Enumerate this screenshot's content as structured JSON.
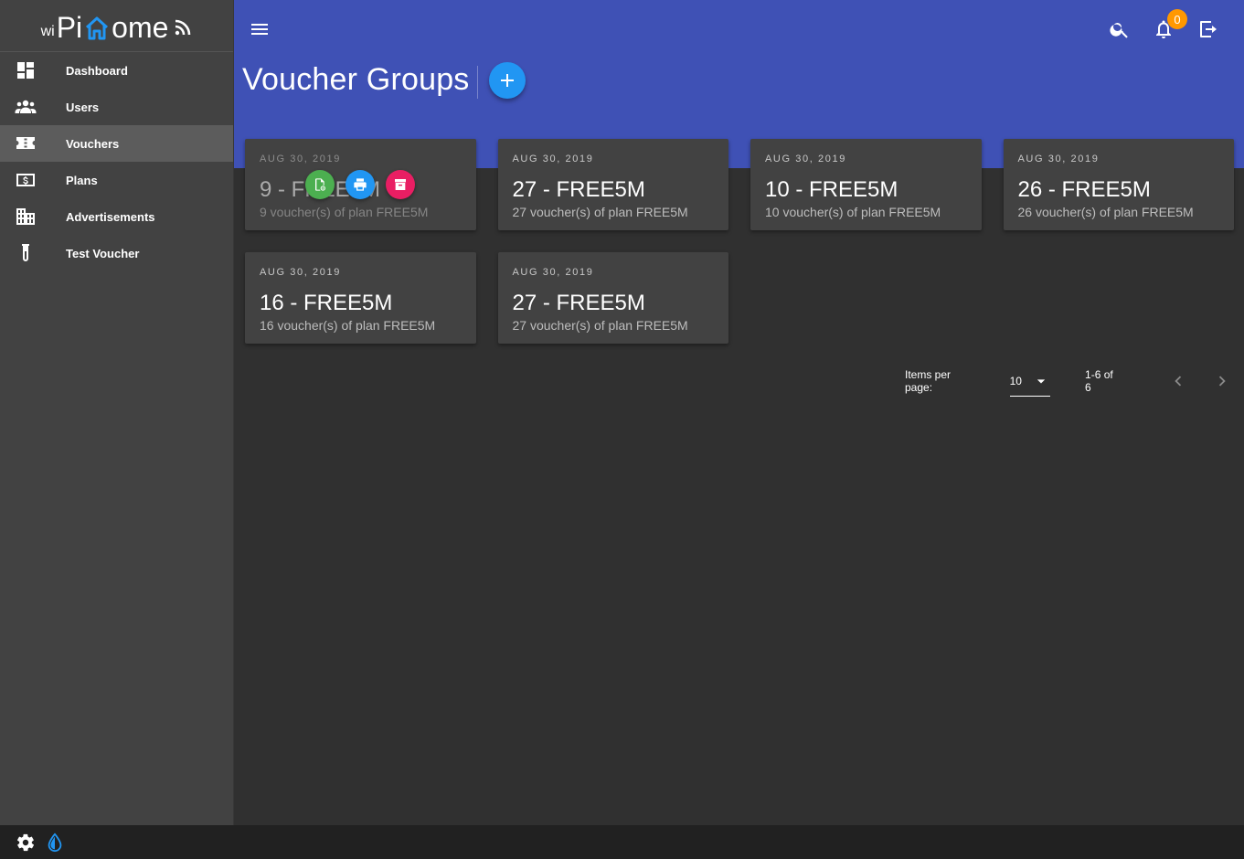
{
  "brand": {
    "prefix": "wi",
    "part1": "Pi",
    "part2": "ome"
  },
  "sidebar": {
    "items": [
      {
        "label": "Dashboard",
        "icon": "dashboard-icon",
        "active": false
      },
      {
        "label": "Users",
        "icon": "users-icon",
        "active": false
      },
      {
        "label": "Vouchers",
        "icon": "ticket-icon",
        "active": true
      },
      {
        "label": "Plans",
        "icon": "plan-dollar-icon",
        "active": false
      },
      {
        "label": "Advertisements",
        "icon": "buildings-icon",
        "active": false
      },
      {
        "label": "Test Voucher",
        "icon": "test-tube-icon",
        "active": false
      }
    ]
  },
  "header": {
    "notifications_count": "0",
    "page_title": "Voucher Groups"
  },
  "cards": [
    {
      "date": "AUG 30, 2019",
      "title": "9 - FREE5M",
      "subtitle": "9 voucher(s) of plan FREE5M"
    },
    {
      "date": "AUG 30, 2019",
      "title": "27 - FREE5M",
      "subtitle": "27 voucher(s) of plan FREE5M"
    },
    {
      "date": "AUG 30, 2019",
      "title": "10 - FREE5M",
      "subtitle": "10 voucher(s) of plan FREE5M"
    },
    {
      "date": "AUG 30, 2019",
      "title": "26 - FREE5M",
      "subtitle": "26 voucher(s) of plan FREE5M"
    },
    {
      "date": "AUG 30, 2019",
      "title": "16 - FREE5M",
      "subtitle": "16 voucher(s) of plan FREE5M"
    },
    {
      "date": "AUG 30, 2019",
      "title": "27 - FREE5M",
      "subtitle": "27 voucher(s) of plan FREE5M"
    }
  ],
  "pagination": {
    "items_per_page_label": "Items per page:",
    "items_per_page": "10",
    "range": "1-6 of 6"
  },
  "colors": {
    "header": "#3f51b5",
    "accent": "#2196f3",
    "sidebar": "#424242",
    "background": "#303030",
    "badge": "#ff9800",
    "action_green": "#4caf50",
    "action_pink": "#e91e63"
  }
}
